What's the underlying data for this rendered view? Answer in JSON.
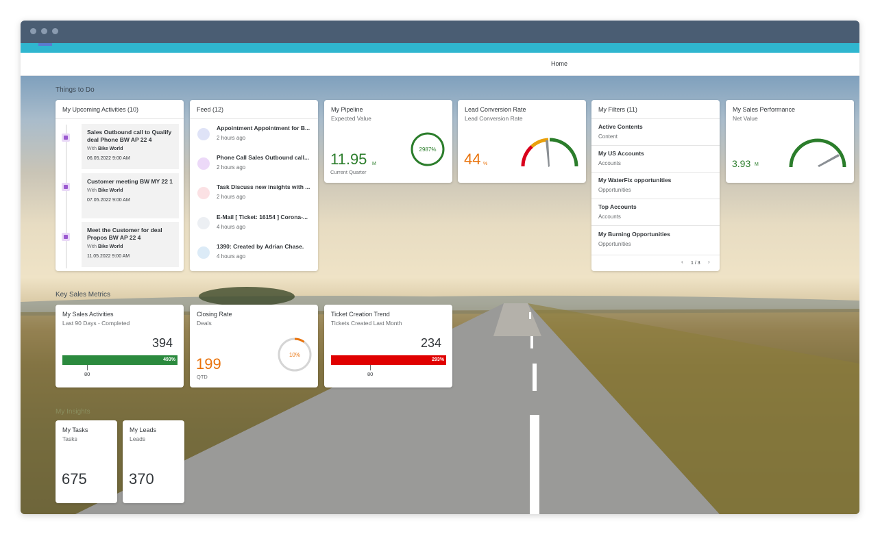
{
  "nav": {
    "home": "Home"
  },
  "sections": {
    "things_to_do": "Things to Do",
    "key_sales_metrics": "Key Sales Metrics",
    "my_insights": "My Insights"
  },
  "activities": {
    "title": "My Upcoming Activities (10)",
    "items": [
      {
        "title": "Sales Outbound call to Qualify deal Phone BW AP 22 4",
        "with_label": "With",
        "with": "Bike World",
        "date": "06.05.2022 9:00 AM"
      },
      {
        "title": "Customer meeting BW MY 22 1",
        "with_label": "With",
        "with": "Bike World",
        "date": "07.05.2022 9:00 AM"
      },
      {
        "title": "Meet the Customer for deal Propos BW AP 22 4",
        "with_label": "With",
        "with": "Bike World",
        "date": "11.05.2022 9:00 AM"
      }
    ]
  },
  "feed": {
    "title": "Feed (12)",
    "items": [
      {
        "text": "Appointment Appointment for B...",
        "time": "2 hours ago",
        "icon": "appointment-icon",
        "color": "#dfe3f7"
      },
      {
        "text": "Phone Call Sales Outbound call...",
        "time": "2 hours ago",
        "icon": "phone-call-icon",
        "color": "#ecd9f8"
      },
      {
        "text": "Task Discuss new insights with ...",
        "time": "2 hours ago",
        "icon": "task-icon",
        "color": "#fbe1e4"
      },
      {
        "text": "E-Mail [ Ticket: 16154 ] Corona-...",
        "time": "4 hours ago",
        "icon": "email-icon",
        "color": "#eceff3"
      },
      {
        "text": "1390: Created by Adrian Chase.",
        "time": "4 hours ago",
        "icon": "ticket-icon",
        "color": "#dcebf7"
      }
    ]
  },
  "pipeline": {
    "title": "My Pipeline",
    "subtitle": "Expected Value",
    "value": "11.95",
    "unit": "M",
    "footer": "Current Quarter",
    "ring_label": "2987%",
    "ring_fraction": 1.0,
    "color": "#2b7d2b"
  },
  "lead_conversion": {
    "title": "Lead Conversion Rate",
    "subtitle": "Lead Conversion Rate",
    "value": "44",
    "unit": "%",
    "color": "#e9730c",
    "gauge_fraction": 0.44
  },
  "filters": {
    "title": "My Filters (11)",
    "items": [
      {
        "name": "Active Contents",
        "type": "Content"
      },
      {
        "name": "My US Accounts",
        "type": "Accounts"
      },
      {
        "name": "My WaterFix opportunities",
        "type": "Opportunities"
      },
      {
        "name": "Top Accounts",
        "type": "Accounts"
      },
      {
        "name": "My Burning Opportunities",
        "type": "Opportunities"
      }
    ],
    "pager": "1 / 3"
  },
  "sales_performance": {
    "title": "My Sales Performance",
    "subtitle": "Net Value",
    "value": "3.93",
    "unit": "M",
    "color": "#2b7d2b",
    "gauge_fraction": 0.82
  },
  "sales_activities": {
    "title": "My Sales Activities",
    "subtitle": "Last 90 Days - Completed",
    "value": "394",
    "bar_label": "493%",
    "target": "80",
    "color": "#2b8a3e",
    "bar_fraction": 1.0
  },
  "closing_rate": {
    "title": "Closing Rate",
    "subtitle": "Deals",
    "value": "199",
    "footer": "QTD",
    "ring_label": "10%",
    "ring_fraction": 0.1,
    "color": "#e9730c"
  },
  "ticket_trend": {
    "title": "Ticket Creation Trend",
    "subtitle": "Tickets Created Last Month",
    "value": "234",
    "bar_label": "293%",
    "target": "80",
    "color": "#e00000",
    "bar_fraction": 1.0
  },
  "tasks": {
    "title": "My Tasks",
    "subtitle": "Tasks",
    "value": "675"
  },
  "leads": {
    "title": "My Leads",
    "subtitle": "Leads",
    "value": "370"
  }
}
